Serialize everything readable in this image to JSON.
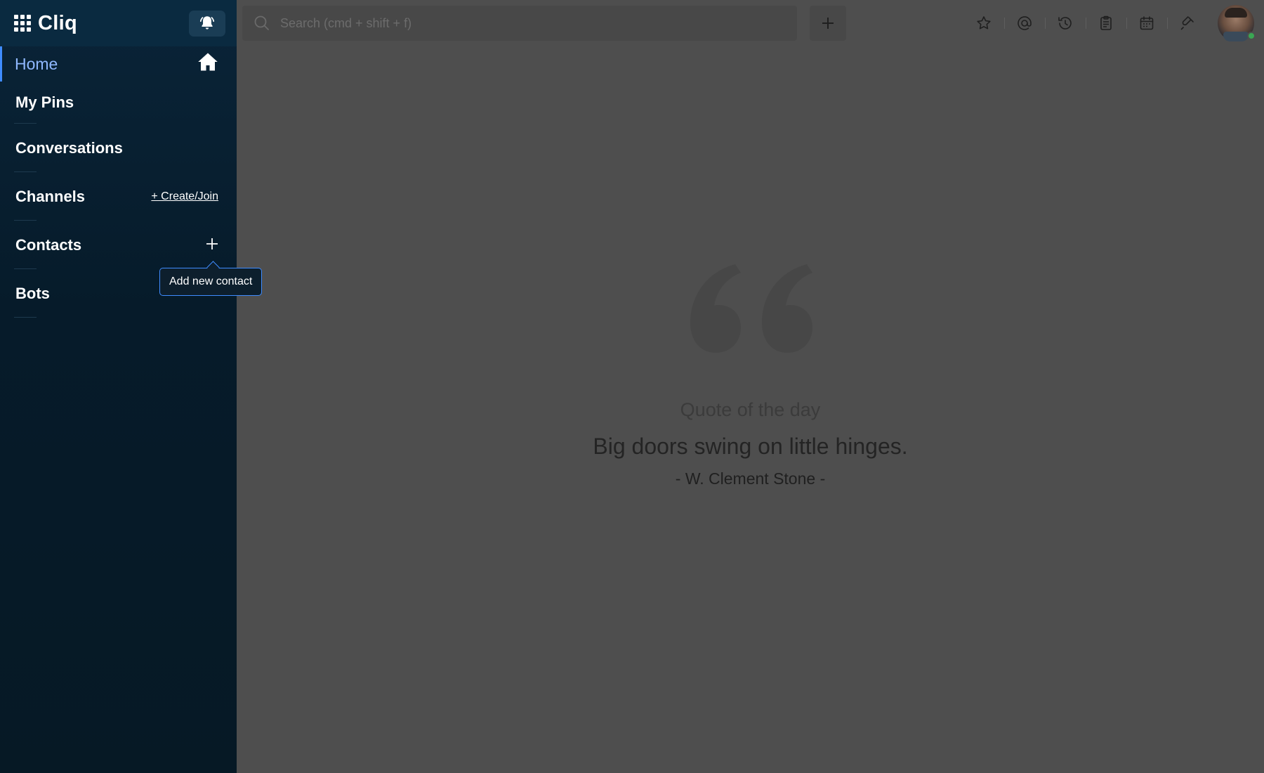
{
  "app": {
    "title": "Cliq"
  },
  "sidebar": {
    "items": [
      {
        "label": "Home"
      },
      {
        "label": "My Pins"
      },
      {
        "label": "Conversations"
      },
      {
        "label": "Channels",
        "action": "+ Create/Join"
      },
      {
        "label": "Contacts"
      },
      {
        "label": "Bots"
      }
    ],
    "tooltip": "Add new contact"
  },
  "search": {
    "placeholder": "Search (cmd + shift + f)"
  },
  "toolbar": {
    "icons": [
      "star-icon",
      "mention-icon",
      "history-icon",
      "clipboard-icon",
      "calendar-icon",
      "plug-icon"
    ]
  },
  "user": {
    "status_color": "#3aa653"
  },
  "quote": {
    "label": "Quote of the day",
    "text": "Big doors swing on little hinges.",
    "author": "- W. Clement Stone -"
  },
  "colors": {
    "sidebar_bg": "#061b2a",
    "main_bg": "#4e4e4e",
    "accent": "#3f8cff",
    "home_text": "#8fb8ff"
  }
}
